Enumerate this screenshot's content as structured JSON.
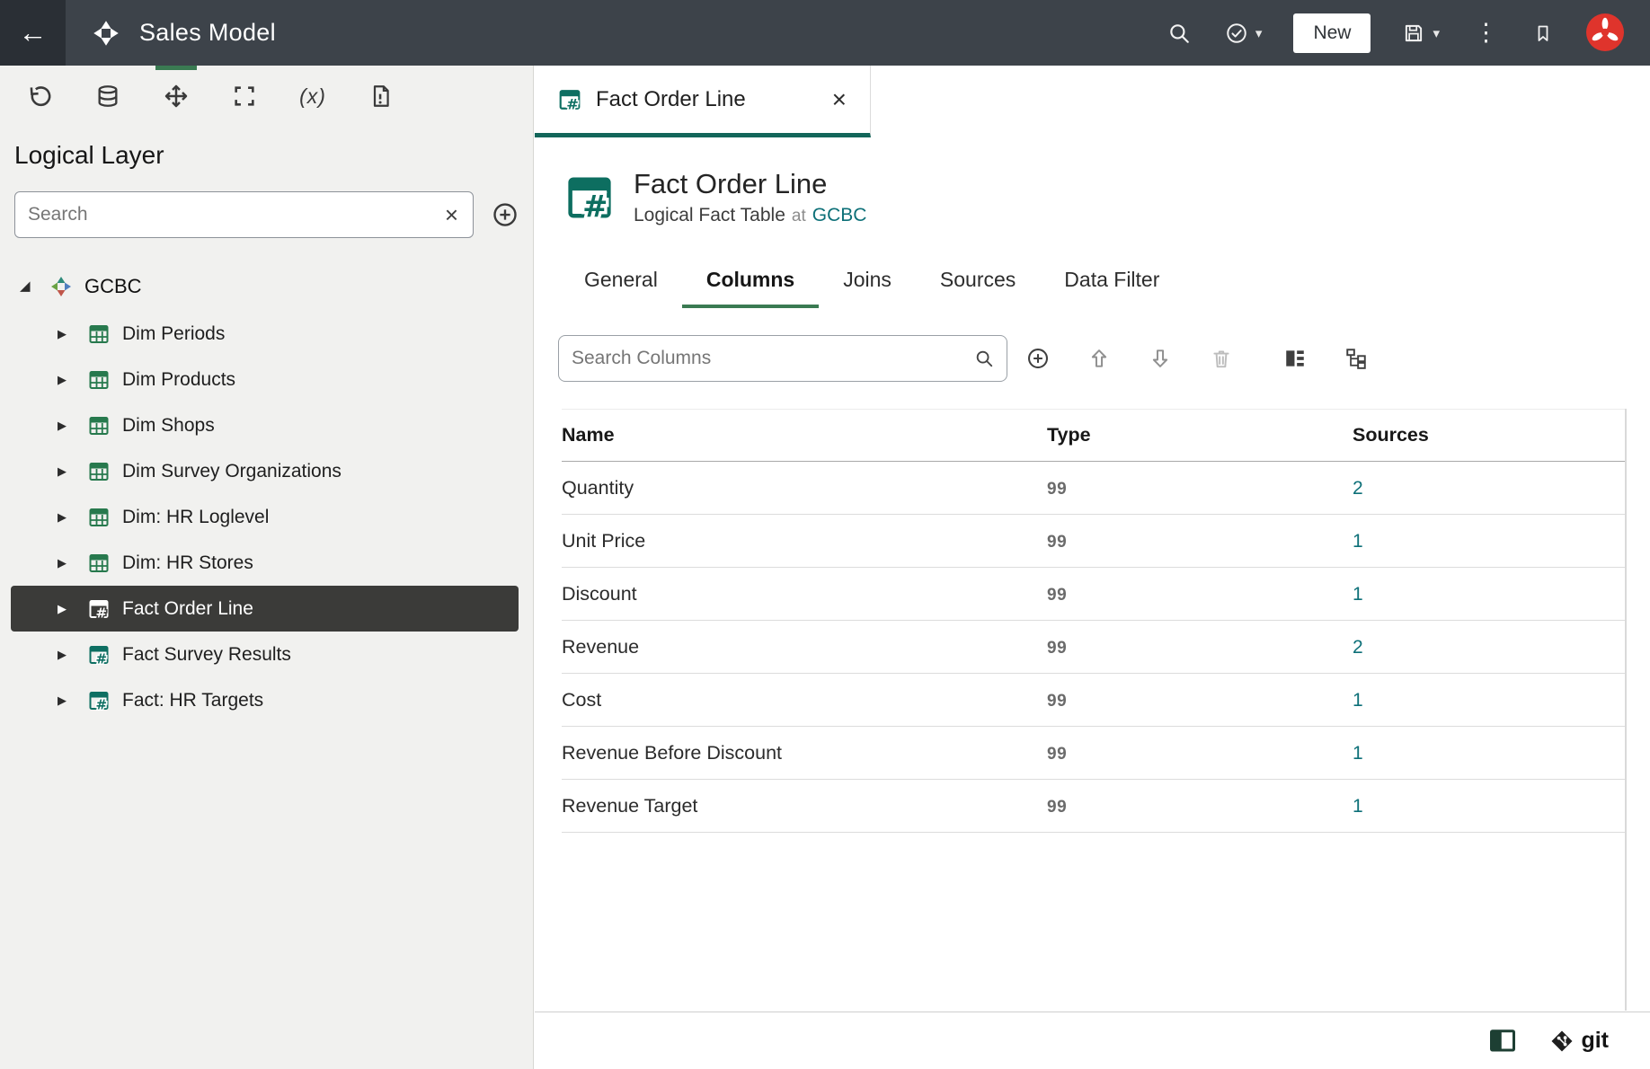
{
  "topbar": {
    "title": "Sales Model",
    "new_button_label": "New"
  },
  "icons": {
    "back": "←",
    "caret_down": "▾",
    "kebab": "⋮",
    "close": "×",
    "caret_collapsed": "▶",
    "caret_expanded": "◢",
    "variables": "(x)"
  },
  "sidebar": {
    "heading": "Logical Layer",
    "search": {
      "placeholder": "Search"
    },
    "tree": {
      "root_label": "GCBC",
      "items": [
        {
          "label": "Dim Periods",
          "kind": "dim"
        },
        {
          "label": "Dim Products",
          "kind": "dim"
        },
        {
          "label": "Dim Shops",
          "kind": "dim"
        },
        {
          "label": "Dim Survey Organizations",
          "kind": "dim"
        },
        {
          "label": "Dim: HR Loglevel",
          "kind": "dim"
        },
        {
          "label": "Dim: HR Stores",
          "kind": "dim"
        },
        {
          "label": "Fact Order Line",
          "kind": "fact",
          "selected": true
        },
        {
          "label": "Fact Survey Results",
          "kind": "fact"
        },
        {
          "label": "Fact: HR Targets",
          "kind": "fact"
        }
      ]
    }
  },
  "main": {
    "doc_tab": {
      "label": "Fact Order Line"
    },
    "header": {
      "title": "Fact Order Line",
      "type_label": "Logical Fact Table",
      "at_label": "at",
      "parent_link": "GCBC"
    },
    "tabs": {
      "general": "General",
      "columns": "Columns",
      "joins": "Joins",
      "sources": "Sources",
      "data_filter": "Data Filter"
    },
    "columns_search": {
      "placeholder": "Search Columns"
    },
    "table": {
      "headers": {
        "name": "Name",
        "type": "Type",
        "sources": "Sources"
      },
      "rows": [
        {
          "name": "Quantity",
          "type": "99",
          "sources": "2"
        },
        {
          "name": "Unit Price",
          "type": "99",
          "sources": "1"
        },
        {
          "name": "Discount",
          "type": "99",
          "sources": "1"
        },
        {
          "name": "Revenue",
          "type": "99",
          "sources": "2"
        },
        {
          "name": "Cost",
          "type": "99",
          "sources": "1"
        },
        {
          "name": "Revenue Before Discount",
          "type": "99",
          "sources": "1"
        },
        {
          "name": "Revenue Target",
          "type": "99",
          "sources": "1"
        }
      ]
    }
  },
  "statusbar": {
    "git_label": "git"
  },
  "colors": {
    "topbar_bg": "#3d434a",
    "accent_green": "#3a7a52",
    "tab_underline_teal": "#13665a",
    "link_teal": "#0d7078",
    "dim_icon_green": "#27794d",
    "fact_icon_teal": "#0e6f62",
    "selected_row_bg": "#3b3b39"
  }
}
